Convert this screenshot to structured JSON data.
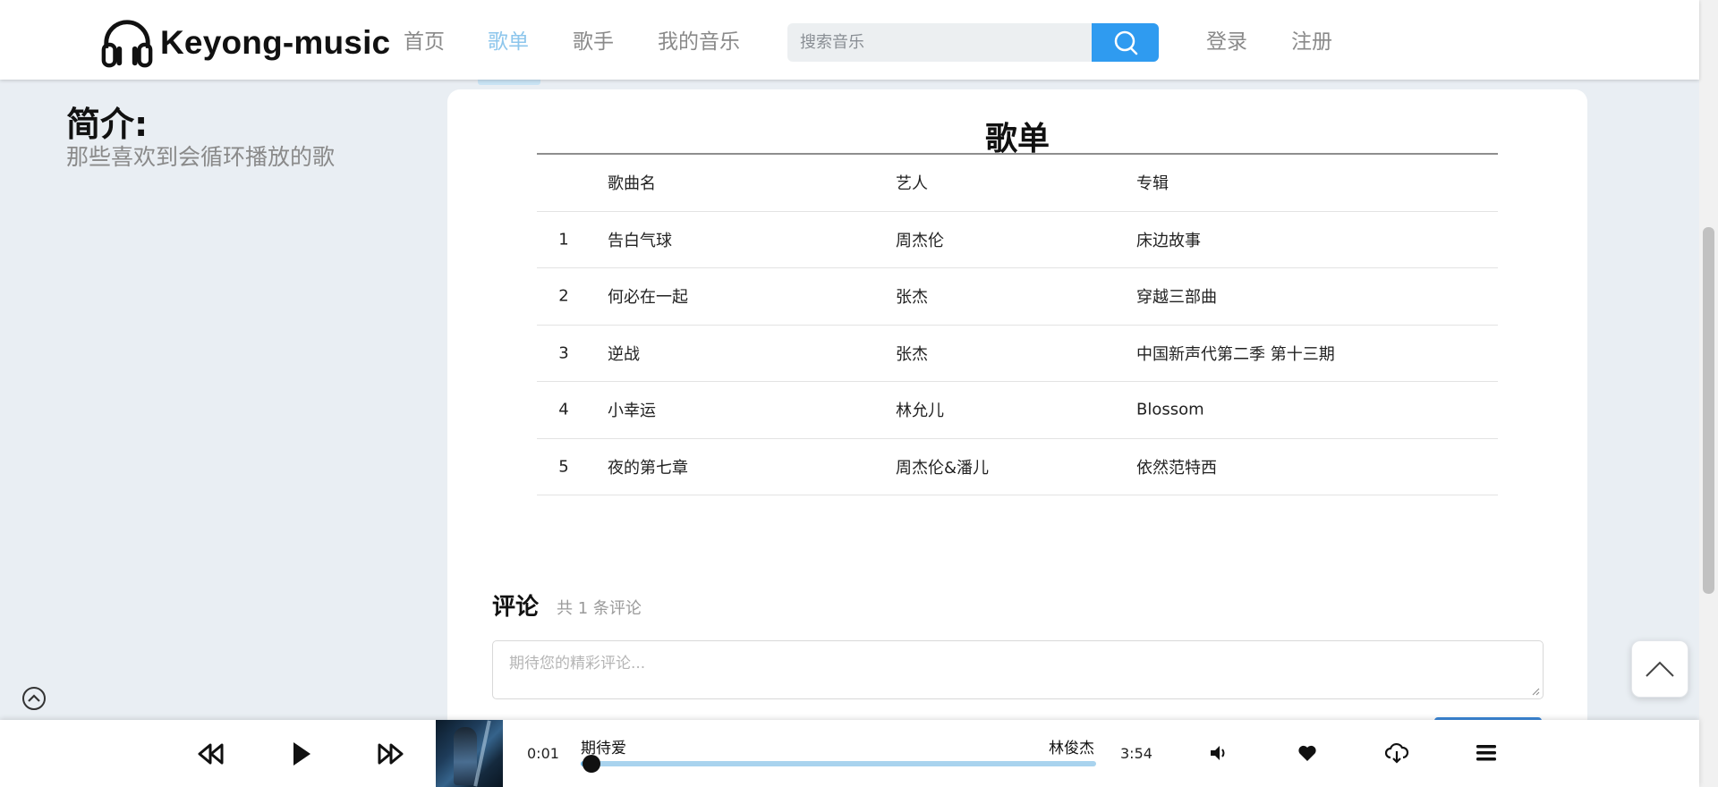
{
  "header": {
    "brand": "Keyong-music",
    "nav": [
      {
        "label": "首页",
        "active": false
      },
      {
        "label": "歌单",
        "active": true
      },
      {
        "label": "歌手",
        "active": false
      },
      {
        "label": "我的音乐",
        "active": false
      }
    ],
    "search_placeholder": "搜索音乐",
    "login_label": "登录",
    "register_label": "注册"
  },
  "intro": {
    "title": "简介:",
    "text": "那些喜欢到会循环播放的歌"
  },
  "playlist": {
    "title": "歌单",
    "columns": [
      "",
      "歌曲名",
      "艺人",
      "专辑"
    ],
    "rows": [
      {
        "index": "1",
        "name": "告白气球",
        "artist": "周杰伦",
        "album": "床边故事"
      },
      {
        "index": "2",
        "name": "何必在一起",
        "artist": "张杰",
        "album": "穿越三部曲"
      },
      {
        "index": "3",
        "name": "逆战",
        "artist": "张杰",
        "album": "中国新声代第二季 第十三期"
      },
      {
        "index": "4",
        "name": "小幸运",
        "artist": "林允儿",
        "album": "Blossom"
      },
      {
        "index": "5",
        "name": "夜的第七章",
        "artist": "周杰伦&潘儿",
        "album": "依然范特西"
      }
    ]
  },
  "comments": {
    "title": "评论",
    "count_text": "共 1 条评论",
    "placeholder": "期待您的精彩评论..."
  },
  "player": {
    "current_time": "0:01",
    "total_time": "3:54",
    "song_title": "期待爱",
    "artist": "林俊杰",
    "progress": 0.02,
    "icons": [
      "rewind-icon",
      "play-icon",
      "fast-forward-icon",
      "volume-icon",
      "heart-icon",
      "cloud-download-icon",
      "menu-icon"
    ]
  },
  "colors": {
    "accent": "#2f9bf0",
    "nav_active": "#8dc6ec",
    "page_bg": "#e9eef3",
    "progress": "#a9d3ee"
  }
}
